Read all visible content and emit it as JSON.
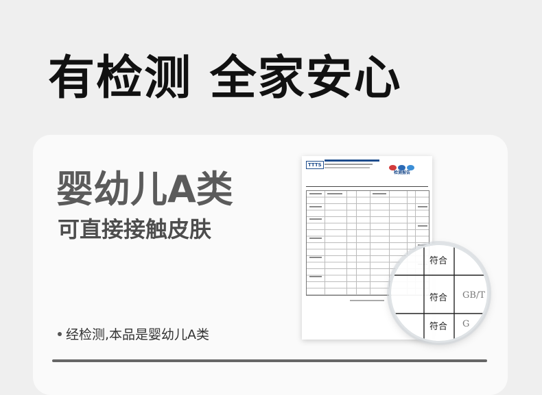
{
  "headline": "有检测 全家安心",
  "card": {
    "title": "婴幼儿A类",
    "subtitle": "可直接接触皮肤",
    "bullet": "经检测,本品是婴幼儿A类"
  },
  "report": {
    "logo": "TTTS",
    "heading": "检测报告"
  },
  "magnifier": {
    "cells": [
      "符合",
      "符合",
      "GB/T",
      "符合",
      "G"
    ]
  },
  "colors": {
    "background": "#efefef",
    "card": "#fafafa",
    "headline": "#111111",
    "title": "#5b5b5b",
    "report_blue": "#1d4c8c"
  }
}
